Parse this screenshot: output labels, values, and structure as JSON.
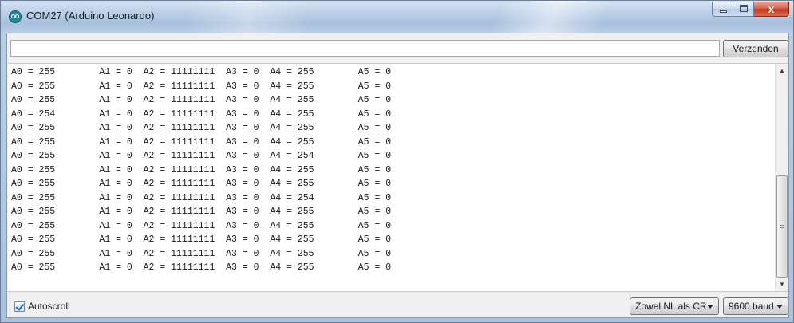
{
  "window": {
    "title": "COM27 (Arduino Leonardo)",
    "icon": "arduino-logo-icon",
    "controls": [
      "minimize-icon",
      "maximize-icon",
      "close-icon"
    ],
    "close_glyph": "x"
  },
  "toolbar": {
    "send_input_value": "",
    "send_label": "Verzenden"
  },
  "serial_output": {
    "lines": [
      "A0 = 255        A1 = 0  A2 = 11111111  A3 = 0  A4 = 255        A5 = 0",
      "A0 = 255        A1 = 0  A2 = 11111111  A3 = 0  A4 = 255        A5 = 0",
      "A0 = 255        A1 = 0  A2 = 11111111  A3 = 0  A4 = 255        A5 = 0",
      "A0 = 254        A1 = 0  A2 = 11111111  A3 = 0  A4 = 255        A5 = 0",
      "A0 = 255        A1 = 0  A2 = 11111111  A3 = 0  A4 = 255        A5 = 0",
      "A0 = 255        A1 = 0  A2 = 11111111  A3 = 0  A4 = 255        A5 = 0",
      "A0 = 255        A1 = 0  A2 = 11111111  A3 = 0  A4 = 254        A5 = 0",
      "A0 = 255        A1 = 0  A2 = 11111111  A3 = 0  A4 = 255        A5 = 0",
      "A0 = 255        A1 = 0  A2 = 11111111  A3 = 0  A4 = 255        A5 = 0",
      "A0 = 255        A1 = 0  A2 = 11111111  A3 = 0  A4 = 254        A5 = 0",
      "A0 = 255        A1 = 0  A2 = 11111111  A3 = 0  A4 = 255        A5 = 0",
      "A0 = 255        A1 = 0  A2 = 11111111  A3 = 0  A4 = 255        A5 = 0",
      "A0 = 255        A1 = 0  A2 = 11111111  A3 = 0  A4 = 255        A5 = 0",
      "A0 = 255        A1 = 0  A2 = 11111111  A3 = 0  A4 = 255        A5 = 0",
      "A0 = 255        A1 = 0  A2 = 11111111  A3 = 0  A4 = 255        A5 = 0"
    ],
    "scroll_position": 1.0
  },
  "footer": {
    "autoscroll_label": "Autoscroll",
    "autoscroll_checked": true,
    "line_ending_selected": "Zowel NL als CR",
    "baud_selected": "9600 baud"
  }
}
